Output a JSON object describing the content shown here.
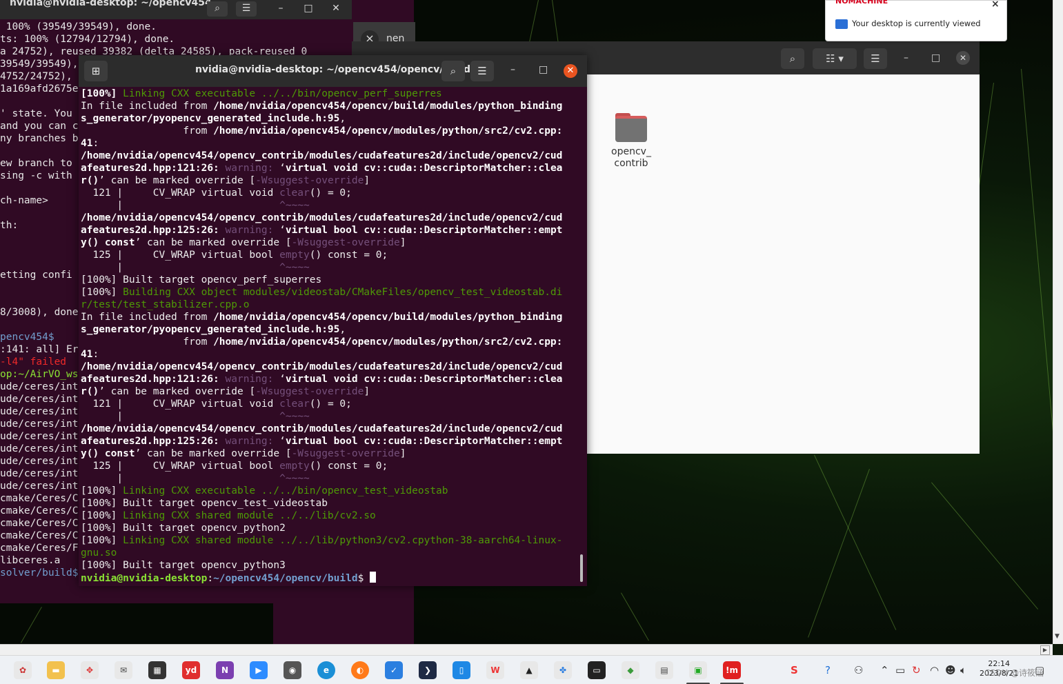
{
  "back_terminal": {
    "title": "nvidia@nvidia-desktop: ~/opencv454",
    "lines": [
      " 100% (39549/39549), done.",
      "ts: 100% (12794/12794), done.",
      "a 24752), reused 39382 (delta 24585), pack-reused 0",
      "39549/39549),",
      "4752/24752),",
      "1a169afd2675e",
      "",
      "' state. You",
      "and you can c",
      "ny branches b",
      "",
      "ew branch to",
      "sing -c with",
      "",
      "ch-name>",
      "",
      "th:",
      "",
      "",
      "",
      "etting confi",
      "",
      "",
      "8/3008), done",
      "",
      "pencv454$",
      ":141: all] Er",
      "-l4\" failed",
      "op:~/AirVO_ws",
      "ude/ceres/int",
      "ude/ceres/int",
      "ude/ceres/int",
      "ude/ceres/int",
      "ude/ceres/int",
      "ude/ceres/int",
      "ude/ceres/int",
      "ude/ceres/int",
      "ude/ceres/int",
      "cmake/Ceres/C",
      "cmake/Ceres/C",
      "cmake/Ceres/C",
      "cmake/Ceres/C",
      "cmake/Ceres/F",
      "libceres.a",
      "solver/build$"
    ]
  },
  "mid_terminal": {
    "tab_text": "nen"
  },
  "file_manager": {
    "folder_label_1": "opencv_",
    "folder_label_2": "contrib"
  },
  "terminal": {
    "title": "nvidia@nvidia-desktop: ~/opencv454/opencv/build",
    "prompt_user": "nvidia@nvidia-desktop",
    "prompt_path": "~/opencv454/opencv/build"
  },
  "notification": {
    "brand": "NOMACHINE",
    "message": "Your desktop is currently viewed"
  },
  "taskbar": {
    "time": "22:14",
    "date": "2023/8/21",
    "watermark": "CSDN @诗筱涵"
  },
  "colors": {
    "terminal_bg": "#300a24",
    "prompt_green": "#8ae234",
    "path_blue": "#729fcf",
    "build_green": "#4e9a06",
    "warning_purple": "#75507b",
    "close_orange": "#e95420"
  }
}
